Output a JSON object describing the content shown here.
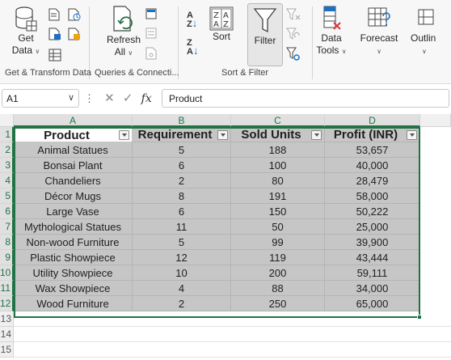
{
  "ribbon": {
    "get_data_line1": "Get",
    "get_data_line2": "Data",
    "refresh_line1": "Refresh",
    "refresh_line2": "All",
    "sort_label": "Sort",
    "filter_label": "Filter",
    "data_tools_line1": "Data",
    "data_tools_line2": "Tools",
    "forecast_label": "Forecast",
    "outline_label": "Outlin",
    "group_get_transform": "Get & Transform Data",
    "group_queries": "Queries & Connecti...",
    "group_sort_filter": "Sort & Filter",
    "accent_color": "#217346"
  },
  "formula_bar": {
    "name_box": "A1",
    "fx_label": "fx",
    "value": "Product"
  },
  "columns": [
    "A",
    "B",
    "C",
    "D"
  ],
  "row_numbers": [
    "1",
    "2",
    "3",
    "4",
    "5",
    "6",
    "7",
    "8",
    "9",
    "10",
    "11",
    "12",
    "13",
    "14",
    "15"
  ],
  "table": {
    "headers": [
      "Product",
      "Requirement",
      "Sold Units",
      "Profit (INR)"
    ],
    "rows": [
      [
        "Animal Statues",
        "5",
        "188",
        "53,657"
      ],
      [
        "Bonsai Plant",
        "6",
        "100",
        "40,000"
      ],
      [
        "Chandeliers",
        "2",
        "80",
        "28,479"
      ],
      [
        "Décor Mugs",
        "8",
        "191",
        "58,000"
      ],
      [
        "Large Vase",
        "6",
        "150",
        "50,222"
      ],
      [
        "Mythological Statues",
        "11",
        "50",
        "25,000"
      ],
      [
        "Non-wood Furniture",
        "5",
        "99",
        "39,900"
      ],
      [
        "Plastic Showpiece",
        "12",
        "119",
        "43,444"
      ],
      [
        "Utility Showpiece",
        "10",
        "200",
        "59,111"
      ],
      [
        "Wax Showpiece",
        "4",
        "88",
        "34,000"
      ],
      [
        "Wood Furniture",
        "2",
        "250",
        "65,000"
      ]
    ]
  }
}
